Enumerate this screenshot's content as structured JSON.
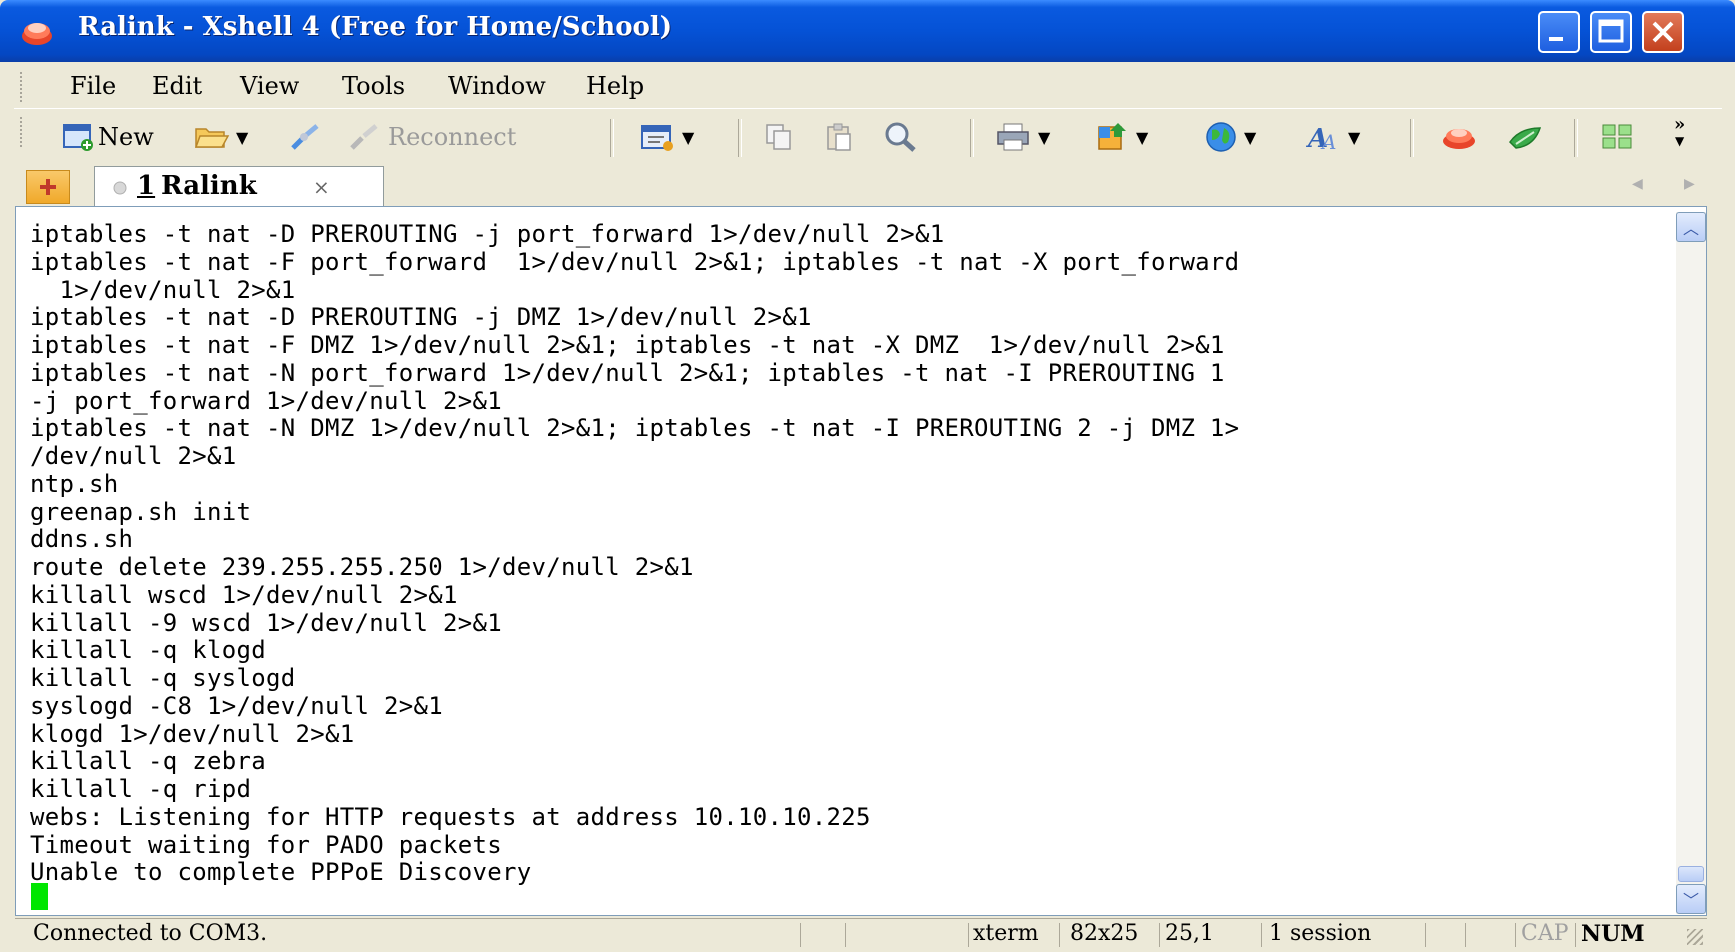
{
  "window": {
    "title": "Ralink - Xshell 4 (Free for Home/School)"
  },
  "menu": [
    "File",
    "Edit",
    "View",
    "Tools",
    "Window",
    "Help"
  ],
  "toolbar": {
    "new_label": "New",
    "reconnect_label": "Reconnect"
  },
  "tabs": {
    "active": {
      "number": "1",
      "label": "Ralink",
      "close": "×"
    }
  },
  "terminal": {
    "lines": [
      "iptables -t nat -D PREROUTING -j port_forward 1>/dev/null 2>&1",
      "iptables -t nat -F port_forward  1>/dev/null 2>&1; iptables -t nat -X port_forward",
      "  1>/dev/null 2>&1",
      "iptables -t nat -D PREROUTING -j DMZ 1>/dev/null 2>&1",
      "iptables -t nat -F DMZ 1>/dev/null 2>&1; iptables -t nat -X DMZ  1>/dev/null 2>&1",
      "iptables -t nat -N port_forward 1>/dev/null 2>&1; iptables -t nat -I PREROUTING 1",
      "-j port_forward 1>/dev/null 2>&1",
      "iptables -t nat -N DMZ 1>/dev/null 2>&1; iptables -t nat -I PREROUTING 2 -j DMZ 1>",
      "/dev/null 2>&1",
      "ntp.sh",
      "greenap.sh init",
      "ddns.sh",
      "route delete 239.255.255.250 1>/dev/null 2>&1",
      "killall wscd 1>/dev/null 2>&1",
      "killall -9 wscd 1>/dev/null 2>&1",
      "killall -q klogd",
      "killall -q syslogd",
      "syslogd -C8 1>/dev/null 2>&1",
      "klogd 1>/dev/null 2>&1",
      "killall -q zebra",
      "killall -q ripd",
      "webs: Listening for HTTP requests at address 10.10.10.225",
      "Timeout waiting for PADO packets",
      "Unable to complete PPPoE Discovery"
    ],
    "cursor_color": "#00e600"
  },
  "status": {
    "connection": "Connected to COM3.",
    "term_type": "xterm",
    "size": "82x25",
    "position": "25,1",
    "sessions": "1 session",
    "cap": "CAP",
    "num": "NUM"
  },
  "colors": {
    "titlebar": "#0552d6",
    "close_button": "#c3401d",
    "chrome": "#ece9d8"
  }
}
